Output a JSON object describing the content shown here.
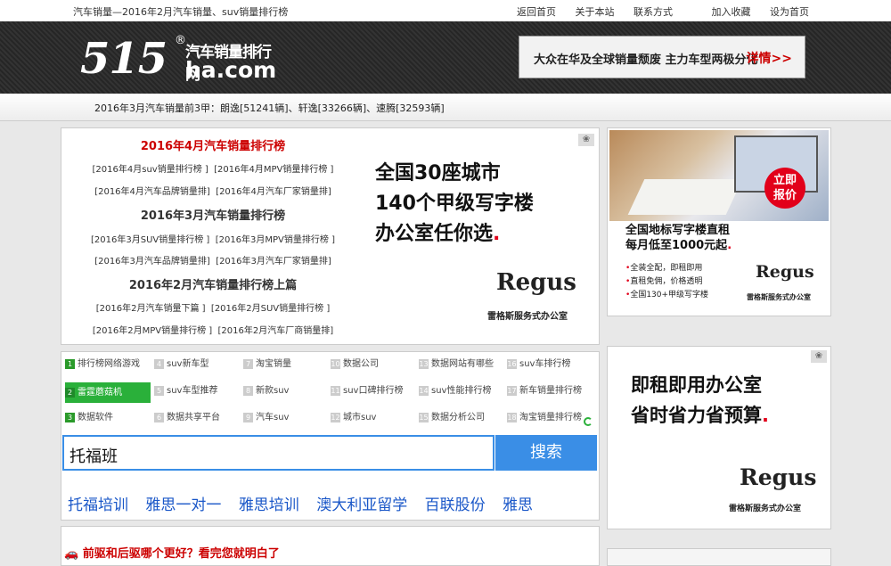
{
  "topbar": {
    "tagline": "汽车销量—2016年2月汽车销量、suv销量排行榜",
    "links": [
      "返回首页",
      "关于本站",
      "联系方式",
      "加入收藏",
      "设为首页"
    ]
  },
  "logo": {
    "num": "515",
    "cn": "汽车销量排行网",
    "domain": "ha.com",
    "reg": "®"
  },
  "promo": {
    "text": "大众在华及全球销量颓废  主力车型两极分化",
    "link": "详情>>"
  },
  "ticker": "2016年3月汽车销量前3甲：朗逸[51241辆]、轩逸[33266辆]、速腾[32593辆]",
  "rankings": [
    {
      "title": "2016年4月汽车销量排行榜",
      "red": true,
      "rows": [
        [
          "[2016年4月suv销量排行榜 ]",
          "[2016年4月MPV销量排行榜 ]"
        ],
        [
          "[2016年4月汽车品牌销量排]",
          "[2016年4月汽车厂家销量排]"
        ]
      ]
    },
    {
      "title": "2016年3月汽车销量排行榜",
      "red": false,
      "rows": [
        [
          "[2016年3月SUV销量排行榜 ]",
          "[2016年3月MPV销量排行榜 ]"
        ],
        [
          "[2016年3月汽车品牌销量排]",
          "[2016年3月汽车厂家销量排]"
        ]
      ]
    },
    {
      "title": "2016年2月汽车销量排行榜上篇",
      "red": false,
      "rows": [
        [
          "[2016年2月汽车销量下篇 ]",
          "[2016年2月SUV销量排行榜 ]"
        ],
        [
          "[2016年2月MPV销量排行榜 ]",
          "[2016年2月汽车厂商销量排]"
        ]
      ]
    }
  ],
  "ad_left": {
    "lines": [
      "全国30座城市",
      "140个甲级写字楼",
      "办公室任你选"
    ],
    "brand": "Regus",
    "brand_sub": "雷格斯服务式办公室"
  },
  "ad_right1": {
    "badge": [
      "立即",
      "报价"
    ],
    "title": [
      "全国地标写字楼直租",
      "每月低至1000元起"
    ],
    "bullets": [
      "全装全配，即租即用",
      "直租免佣，价格透明",
      "全国130+甲级写字楼"
    ],
    "brand": "Regus",
    "brand_sub": "雷格斯服务式办公室"
  },
  "ad_right2": {
    "lines": [
      "即租即用办公室",
      "省时省力省预算"
    ],
    "brand": "Regus",
    "brand_sub": "雷格斯服务式办公室"
  },
  "keywords": [
    [
      "排行榜网络游戏",
      "suv新车型",
      "淘宝销量",
      "数据公司",
      "数据网站有哪些",
      "suv车排行榜"
    ],
    [
      "雷霆蘑菇机",
      "suv车型推荐",
      "新款suv",
      "suv口碑排行榜",
      "suv性能排行榜",
      "新车销量排行榜"
    ],
    [
      "数据软件",
      "数据共享平台",
      "汽车suv",
      "城市suv",
      "数据分析公司",
      "淘宝销量排行榜"
    ]
  ],
  "search": {
    "value": "托福班",
    "button": "搜索"
  },
  "related": [
    "托福培训",
    "雅思一对一",
    "雅思培训",
    "澳大利亚留学",
    "百联股份",
    "雅思"
  ],
  "news": "前驱和后驱哪个更好？看完您就明白了",
  "colors": {
    "accent_red": "#cc0000",
    "link_blue": "#1a57c8",
    "search_blue": "#3a8ee6",
    "highlight_green": "#2ab03a"
  }
}
